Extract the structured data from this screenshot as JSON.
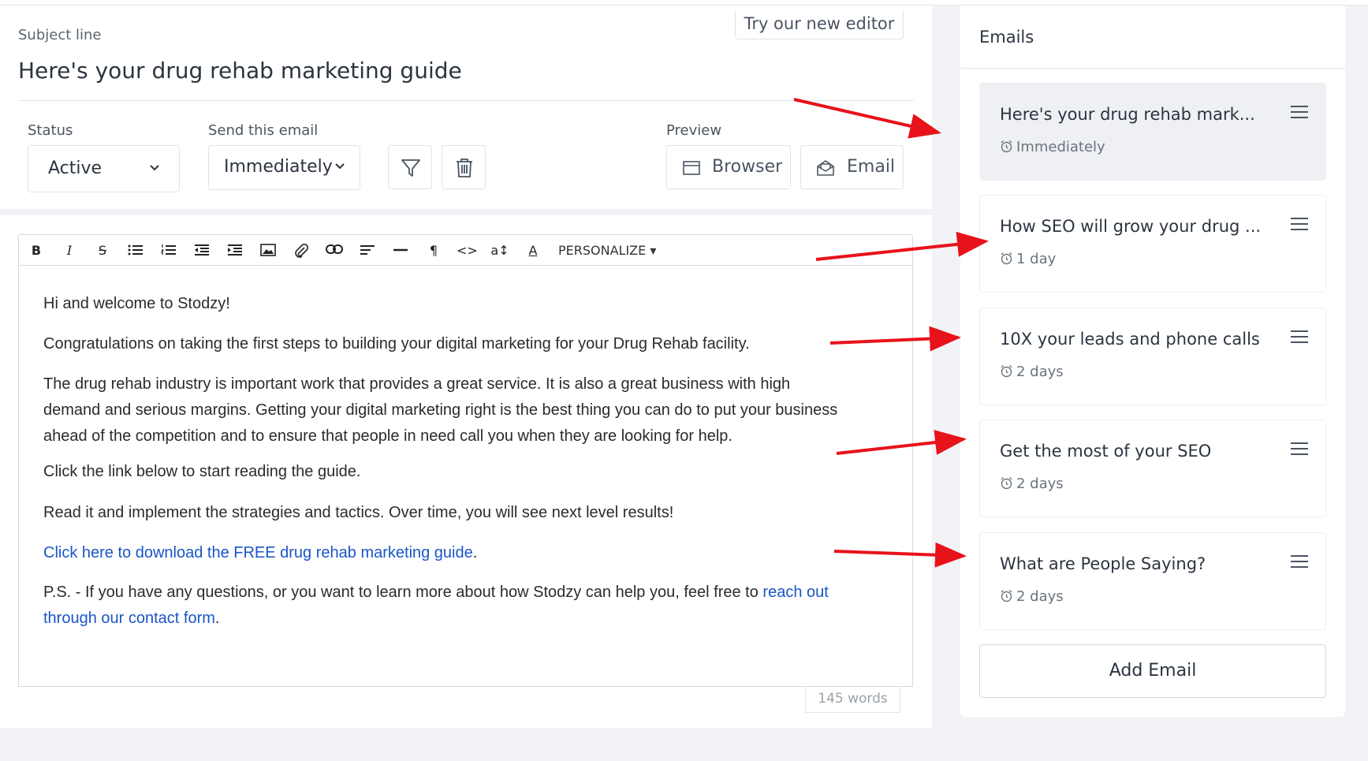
{
  "subject": {
    "label": "Subject line",
    "title": "Here's your drug rehab marketing guide"
  },
  "try_editor": "Try our new editor",
  "status": {
    "label": "Status",
    "value": "Active"
  },
  "send": {
    "label": "Send this email",
    "value": "Immediately"
  },
  "preview": {
    "label": "Preview",
    "browser": "Browser",
    "email": "Email"
  },
  "toolbar": {
    "personalize": "PERSONALIZE",
    "bold": "B",
    "italic": "I",
    "strike": "S",
    "paragraph": "¶",
    "code": "<>",
    "font_size": "a↕",
    "font_color": "A"
  },
  "editor": {
    "p1": "Hi and welcome to Stodzy!",
    "p2": "Congratulations on taking the first steps to building your digital marketing for your Drug Rehab facility.",
    "p3_l1": "The drug rehab industry is important work that provides a great service. It is also a great business with high",
    "p3_l2": "demand and serious margins. Getting your digital marketing right is the best thing you can do to put your business",
    "p3_l3": "ahead of the competition and to ensure that people in need call you when they are looking for help.",
    "p4": "Click the link below to start reading the guide.",
    "p5": "Read it and implement the strategies and tactics. Over time, you will see next level results!",
    "p6_link": "Click here to download the FREE drug rehab marketing guide",
    "p6_end": ".",
    "p7_a": "P.S. - If you have any questions, or you want to learn more about how Stodzy can help you, feel free to ",
    "p7_link1": "reach out",
    "p7_link2": "through our contact form",
    "p7_end": "."
  },
  "word_count": "145 words",
  "sidebar": {
    "title": "Emails",
    "emails": [
      {
        "title": "Here's your drug rehab mark...",
        "time": "Immediately"
      },
      {
        "title": "How SEO will grow your drug ...",
        "time": "1 day"
      },
      {
        "title": "10X your leads and phone calls",
        "time": "2 days"
      },
      {
        "title": "Get the most of your SEO",
        "time": "2 days"
      },
      {
        "title": "What are People Saying?",
        "time": "2 days"
      }
    ],
    "add_email": "Add Email"
  },
  "colors": {
    "arrow": "#e8121b",
    "link": "#1a55c7",
    "active_card": "#eef0f3"
  }
}
